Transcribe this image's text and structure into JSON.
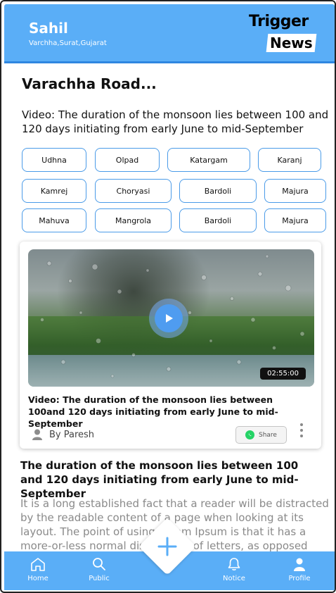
{
  "header": {
    "user_name": "Sahil",
    "user_location": "Varchha,Surat,Gujarat",
    "logo_top": "Trigger",
    "logo_bottom": "News"
  },
  "location_title": "Varachha Road...",
  "lead_text": "Video: The duration of the monsoon lies between 100 and  120 days initiating from early June to mid-September",
  "chips": [
    [
      "Udhna",
      "Olpad",
      "Katargam",
      "Karanj"
    ],
    [
      "Kamrej",
      "Choryasi",
      "Bardoli",
      "Majura"
    ],
    [
      "Mahuva",
      "Mangrola",
      "Bardoli",
      "Majura"
    ]
  ],
  "video_card": {
    "duration": "02:55:00",
    "title": "Video: The duration of the monsoon lies between 100and 120 days initiating from early June to mid-September",
    "author": "By Paresh",
    "share_label": "Share"
  },
  "article": {
    "title": "The duration of the monsoon lies between 100 and 120 days initiating from early June to mid-September",
    "body": "It is a long established fact that a reader will be distracted by the readable content of a page when looking at its layout. The point of using Lorem Ipsum is that it has a more-or-less normal distribution of letters, as opposed"
  },
  "bottom_nav": {
    "home": "Home",
    "public": "Public",
    "notice": "Notice",
    "profile": "Profile"
  },
  "colors": {
    "primary": "#5aaef7",
    "chip_border": "#4a9be8",
    "whatsapp": "#25d366"
  }
}
